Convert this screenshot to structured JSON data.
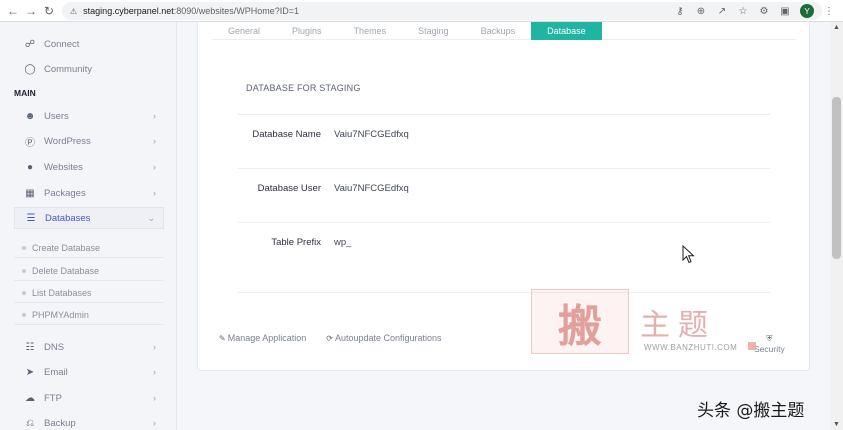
{
  "browser": {
    "url_host": "staging.cyberpanel.net",
    "url_path": ":8090/websites/WPHome?ID=1",
    "profile_initial": "Y"
  },
  "sidebar": {
    "top_items": [
      {
        "label": "Connect",
        "icon": "link-icon"
      },
      {
        "label": "Community",
        "icon": "chat-icon"
      }
    ],
    "section_label": "MAIN",
    "items": [
      {
        "label": "Users",
        "icon": "users-icon"
      },
      {
        "label": "WordPress",
        "icon": "wordpress-icon"
      },
      {
        "label": "Websites",
        "icon": "globe-icon"
      },
      {
        "label": "Packages",
        "icon": "packages-icon"
      },
      {
        "label": "Databases",
        "icon": "database-icon"
      }
    ],
    "db_sub_items": [
      "Create Database",
      "Delete Database",
      "List Databases",
      "PHPMYAdmin"
    ],
    "lower_items": [
      {
        "label": "DNS",
        "icon": "sitemap-icon"
      },
      {
        "label": "Email",
        "icon": "paper-plane-icon"
      },
      {
        "label": "FTP",
        "icon": "cloud-upload-icon"
      },
      {
        "label": "Backup",
        "icon": "backup-icon"
      }
    ]
  },
  "tabs": [
    "General",
    "Plugins",
    "Themes",
    "Staging",
    "Backups",
    "Database"
  ],
  "active_tab": "Database",
  "section_title": "DATABASE FOR STAGING",
  "fields": [
    {
      "label": "Database Name",
      "value": "Vaiu7NFCGEdfxq"
    },
    {
      "label": "Database User",
      "value": "Vaiu7NFCGEdfxq"
    },
    {
      "label": "Table Prefix",
      "value": "wp_"
    }
  ],
  "footer_links": [
    "Manage Application",
    "Autoupdate Configurations"
  ],
  "security_label": "Security",
  "watermark": {
    "logo_char": "搬",
    "side_text": "主题",
    "url": "WWW.BANZHUTI.COM",
    "credit": "头条 @搬主题"
  },
  "colors": {
    "accent_teal": "#1fb5a2",
    "active_nav": "#4a54c8"
  }
}
